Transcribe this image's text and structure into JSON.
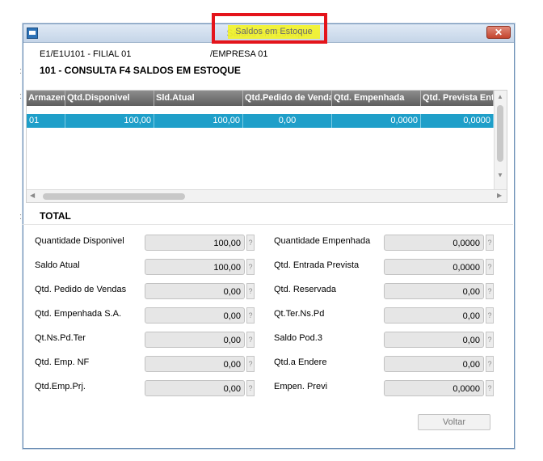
{
  "window": {
    "title": "Saldos em Estoque",
    "close_glyph": "✕"
  },
  "header": {
    "branch": "E1/E1U101 - FILIAL 01",
    "company": "/EMPRESA 01",
    "consult_title": "101 - CONSULTA F4 SALDOS EM ESTOQUE"
  },
  "grid": {
    "columns": [
      "Armazem",
      "Qtd.Disponivel",
      "Sld.Atual",
      "Qtd.Pedido de Vendas",
      "Qtd. Empenhada",
      "Qtd. Prevista Ent"
    ],
    "rows": [
      [
        "01",
        "100,00",
        "100,00",
        "0,00",
        "0,0000",
        "0,0000"
      ]
    ]
  },
  "total": {
    "label": "TOTAL",
    "left_fields": [
      {
        "label": "Quantidade Disponivel",
        "value": "100,00"
      },
      {
        "label": "Saldo Atual",
        "value": "100,00"
      },
      {
        "label": "Qtd. Pedido de Vendas",
        "value": "0,00"
      },
      {
        "label": "Qtd. Empenhada S.A.",
        "value": "0,00"
      },
      {
        "label": "Qt.Ns.Pd.Ter",
        "value": "0,00"
      },
      {
        "label": "Qtd. Emp. NF",
        "value": "0,00"
      },
      {
        "label": "Qtd.Emp.Prj.",
        "value": "0,00"
      }
    ],
    "right_fields": [
      {
        "label": "Quantidade Empenhada",
        "value": "0,0000"
      },
      {
        "label": "Qtd. Entrada Prevista",
        "value": "0,0000"
      },
      {
        "label": "Qtd. Reservada",
        "value": "0,00"
      },
      {
        "label": "Qt.Ter.Ns.Pd",
        "value": "0,00"
      },
      {
        "label": "Saldo Pod.3",
        "value": "0,00"
      },
      {
        "label": "Qtd.a Endere",
        "value": "0,00"
      },
      {
        "label": "Empen. Previ",
        "value": "0,0000"
      }
    ],
    "help_glyph": "?"
  },
  "buttons": {
    "voltar": "Voltar"
  },
  "colors": {
    "highlight_border": "#e4141b",
    "highlight_fill": "#f4f41a",
    "selected_row": "#1f9fc9"
  }
}
